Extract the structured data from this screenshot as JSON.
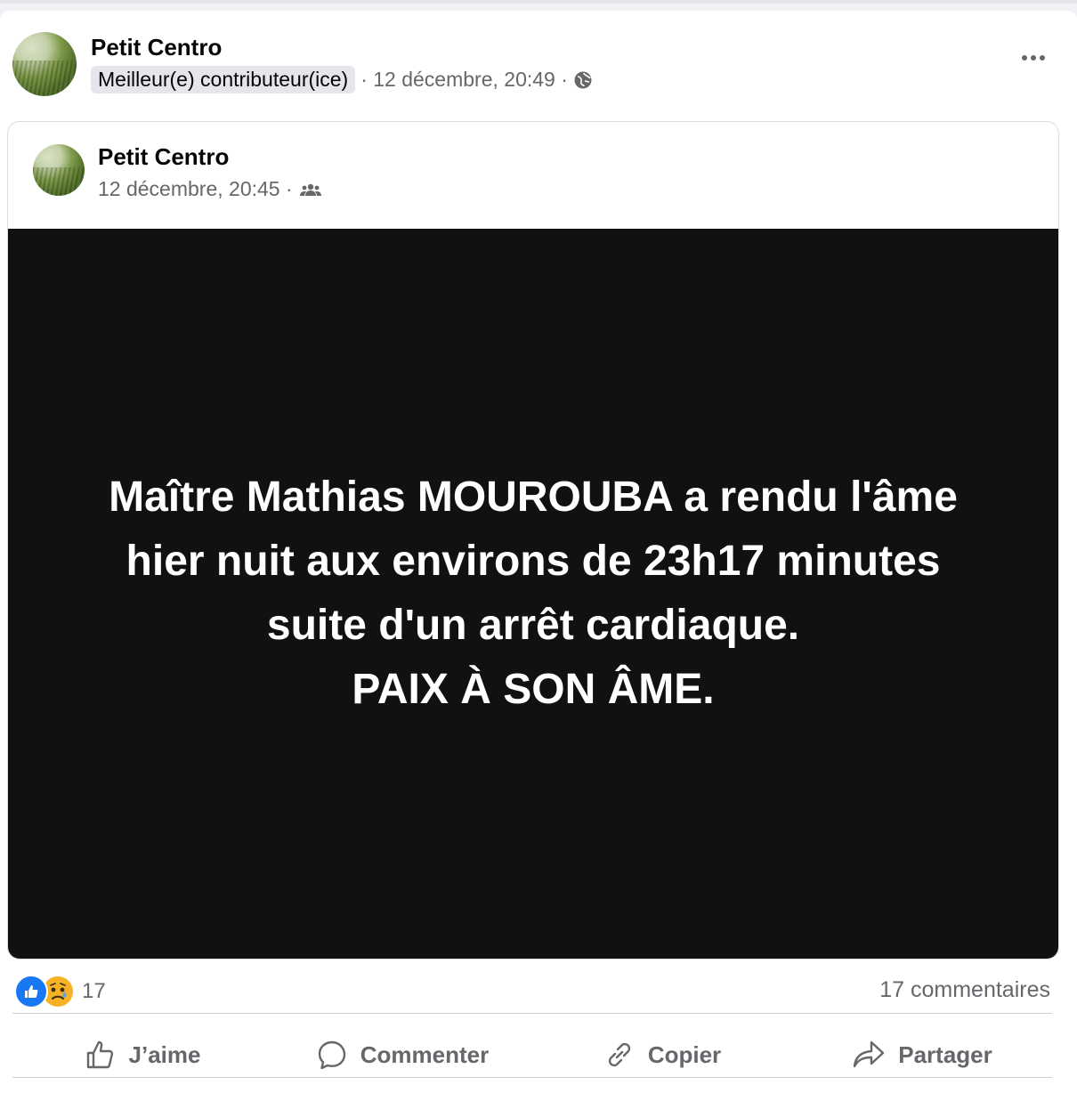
{
  "post": {
    "author": "Petit Centro",
    "badge": "Meilleur(e) contributeur(ice)",
    "timestamp": "· 12 décembre, 20:49 ·",
    "privacy_icon": "globe-icon",
    "menu_icon": "more-icon"
  },
  "shared_post": {
    "author": "Petit Centro",
    "timestamp": "12 décembre, 20:45 ·",
    "privacy_icon": "group-icon",
    "text": "Maître Mathias MOUROUBA a rendu l'âme\nhier nuit aux environs de 23h17 minutes\nsuite d'un arrêt cardiaque.\nPAIX À SON ÂME.",
    "background_color": "#111111"
  },
  "stats": {
    "reactions": [
      "like",
      "sad"
    ],
    "reaction_count": "17",
    "comments": "17 commentaires"
  },
  "actions": [
    {
      "label": "J’aime",
      "icon": "thumbs-up-icon"
    },
    {
      "label": "Commenter",
      "icon": "comment-icon"
    },
    {
      "label": "Copier",
      "icon": "link-icon"
    },
    {
      "label": "Partager",
      "icon": "share-icon"
    }
  ]
}
